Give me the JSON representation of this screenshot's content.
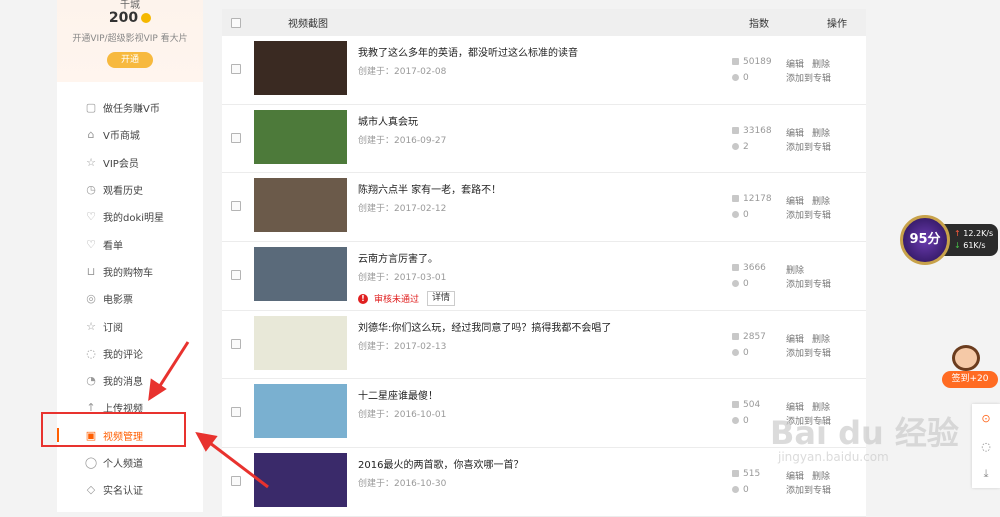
{
  "sidebar": {
    "level": "千城",
    "coins": "200",
    "vip_text": "开通VIP/超级影视VIP 看大片",
    "open_label": "开通",
    "items": [
      {
        "label": "做任务赚V币",
        "icon": "task-icon",
        "glyph": "▢"
      },
      {
        "label": "V币商城",
        "icon": "shop-icon",
        "glyph": "⌂"
      },
      {
        "label": "VIP会员",
        "icon": "vip-star-icon",
        "glyph": "☆"
      },
      {
        "label": "观看历史",
        "icon": "clock-icon",
        "glyph": "◷"
      },
      {
        "label": "我的doki明星",
        "icon": "heart-icon",
        "glyph": "♡"
      },
      {
        "label": "看单",
        "icon": "list-heart-icon",
        "glyph": "♡"
      },
      {
        "label": "我的购物车",
        "icon": "cart-icon",
        "glyph": "⊔"
      },
      {
        "label": "电影票",
        "icon": "ticket-icon",
        "glyph": "◎"
      },
      {
        "label": "订阅",
        "icon": "star-icon",
        "glyph": "☆"
      },
      {
        "label": "我的评论",
        "icon": "comment-icon",
        "glyph": "◌"
      },
      {
        "label": "我的消息",
        "icon": "bell-icon",
        "glyph": "◔"
      },
      {
        "label": "上传视频",
        "icon": "upload-icon",
        "glyph": "↑"
      },
      {
        "label": "视频管理",
        "icon": "video-manage-icon",
        "glyph": "▣"
      },
      {
        "label": "个人频道",
        "icon": "user-icon",
        "glyph": "◯"
      },
      {
        "label": "实名认证",
        "icon": "shield-icon",
        "glyph": "◇"
      }
    ]
  },
  "table": {
    "headers": {
      "thumbnail": "视频截图",
      "index": "指数",
      "ops": "操作"
    },
    "rows": [
      {
        "title": "我教了这么多年的英语，都没听过这么标准的读音",
        "created": "创建于：2017-02-08",
        "plays": "50189",
        "comments": "0",
        "edit": "编辑",
        "del": "删除",
        "add": "添加到专辑",
        "thumb_color": "#3a2a22"
      },
      {
        "title": "城市人真会玩",
        "created": "创建于：2016-09-27",
        "plays": "33168",
        "comments": "2",
        "edit": "编辑",
        "del": "删除",
        "add": "添加到专辑",
        "thumb_color": "#4d7a3a"
      },
      {
        "title": "陈翔六点半 家有一老，套路不！",
        "created": "创建于：2017-02-12",
        "plays": "12178",
        "comments": "0",
        "edit": "编辑",
        "del": "删除",
        "add": "添加到专辑",
        "thumb_color": "#6b5a4a"
      },
      {
        "title": "云南方言厉害了。",
        "created": "创建于：2017-03-01",
        "plays": "3666",
        "comments": "0",
        "edit": "",
        "del": "删除",
        "add": "添加到专辑",
        "warn": "审核未通过",
        "detail": "详情",
        "thumb_color": "#5a6a7a"
      },
      {
        "title": "刘德华:你们这么玩，经过我同意了吗？搞得我都不会唱了",
        "created": "创建于：2017-02-13",
        "plays": "2857",
        "comments": "0",
        "edit": "编辑",
        "del": "删除",
        "add": "添加到专辑",
        "thumb_color": "#e8e8d8"
      },
      {
        "title": "十二星座谁最傻！",
        "created": "创建于：2016-10-01",
        "plays": "504",
        "comments": "0",
        "edit": "编辑",
        "del": "删除",
        "add": "添加到专辑",
        "thumb_color": "#7ab0d0"
      },
      {
        "title": "2016最火的两首歌，你喜欢哪一首？",
        "created": "创建于：2016-10-30",
        "plays": "515",
        "comments": "0",
        "edit": "编辑",
        "del": "删除",
        "add": "添加到专辑",
        "thumb_color": "#3a2a6a"
      }
    ]
  },
  "speed_widget": {
    "score": "95分",
    "up": "12.2K/s",
    "down": "61K/s"
  },
  "signin": {
    "label": "签到+20"
  },
  "watermark": {
    "brand": "Bai du 经验",
    "url": "jingyan.baidu.com"
  },
  "colors": {
    "accent": "#ff5e00",
    "highlight": "#e8322e"
  }
}
